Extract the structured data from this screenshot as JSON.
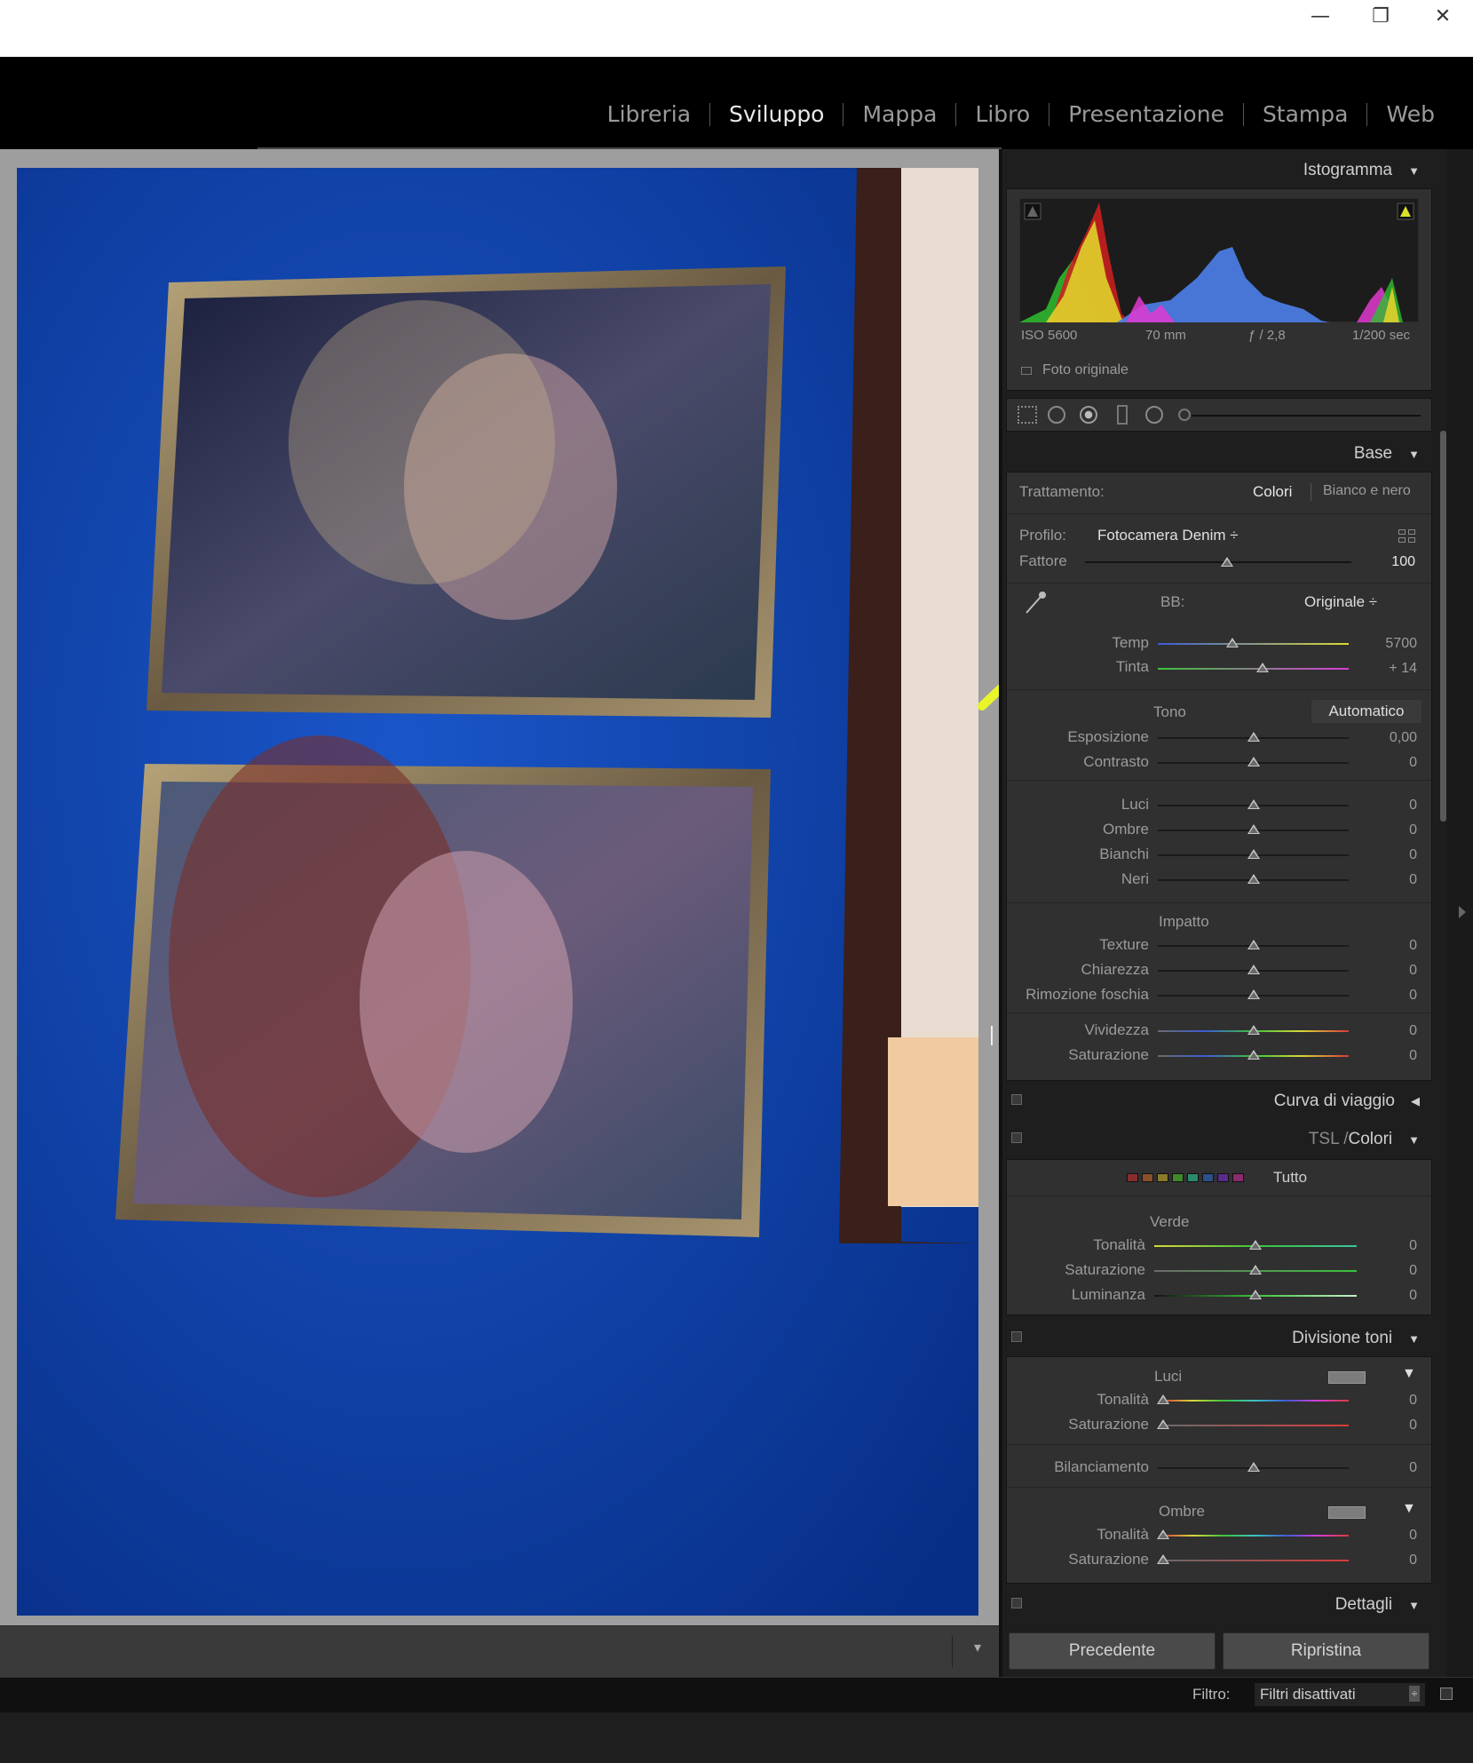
{
  "window": {
    "minimize": "—",
    "restore": "❐",
    "close": "✕"
  },
  "modules": [
    "Libreria",
    "Sviluppo",
    "Mappa",
    "Libro",
    "Presentazione",
    "Stampa",
    "Web"
  ],
  "active_module": "Sviluppo",
  "histogram": {
    "title": "Istogramma",
    "iso": "ISO 5600",
    "focal": "70 mm",
    "aperture": "ƒ / 2,8",
    "shutter": "1/200 sec",
    "original_photo": "Foto originale"
  },
  "base": {
    "title": "Base",
    "treatment_label": "Trattamento:",
    "treatment_color": "Colori",
    "treatment_bw": "Bianco e nero",
    "profile_label": "Profilo:",
    "profile_value": "Fotocamera Denim ÷",
    "amount_label": "Fattore",
    "amount_value": "100",
    "wb_label": "BB:",
    "wb_value": "Originale ÷",
    "temp_label": "Temp",
    "temp_value": "5700",
    "tint_label": "Tinta",
    "tint_value": "+ 14",
    "tone_label": "Tono",
    "auto_label": "Automatico",
    "exposure_label": "Esposizione",
    "exposure_value": "0,00",
    "contrast_label": "Contrasto",
    "contrast_value": "0",
    "highlights_label": "Luci",
    "highlights_value": "0",
    "shadows_label": "Ombre",
    "shadows_value": "0",
    "whites_label": "Bianchi",
    "whites_value": "0",
    "blacks_label": "Neri",
    "blacks_value": "0",
    "presence_label": "Impatto",
    "texture_label": "Texture",
    "texture_value": "0",
    "clarity_label": "Chiarezza",
    "clarity_value": "0",
    "dehaze_label": "Rimozione foschia",
    "dehaze_value": "0",
    "vibrance_label": "Vividezza",
    "vibrance_value": "0",
    "saturation_label": "Saturazione",
    "saturation_value": "0"
  },
  "tone_curve": {
    "title": "Curva di viaggio"
  },
  "hsl": {
    "title_prefix": "TSL / ",
    "title": "Colori",
    "all_label": "Tutto",
    "swatch_colors": [
      "#8a2b2b",
      "#8a4f2b",
      "#8a7a2b",
      "#3f8a2b",
      "#2b8a6e",
      "#2b4f8a",
      "#5a2b8a",
      "#8a2b6e"
    ],
    "group_label": "Verde",
    "hue_label": "Tonalità",
    "hue_value": "0",
    "sat_label": "Saturazione",
    "sat_value": "0",
    "lum_label": "Luminanza",
    "lum_value": "0"
  },
  "split_toning": {
    "title": "Divisione toni",
    "highlights_label": "Luci",
    "hl_hue_label": "Tonalità",
    "hl_hue_value": "0",
    "hl_sat_label": "Saturazione",
    "hl_sat_value": "0",
    "balance_label": "Bilanciamento",
    "balance_value": "0",
    "shadows_label": "Ombre",
    "sh_hue_label": "Tonalità",
    "sh_hue_value": "0",
    "sh_sat_label": "Saturazione",
    "sh_sat_value": "0"
  },
  "details": {
    "title": "Dettagli"
  },
  "buttons": {
    "previous": "Precedente",
    "reset": "Ripristina"
  },
  "filter": {
    "label": "Filtro:",
    "value": "Filtri disattivati"
  },
  "colors": {
    "annotation": "#e8f52a",
    "photo_wall": "#0b3d9e",
    "frame": "#8a7a55"
  }
}
